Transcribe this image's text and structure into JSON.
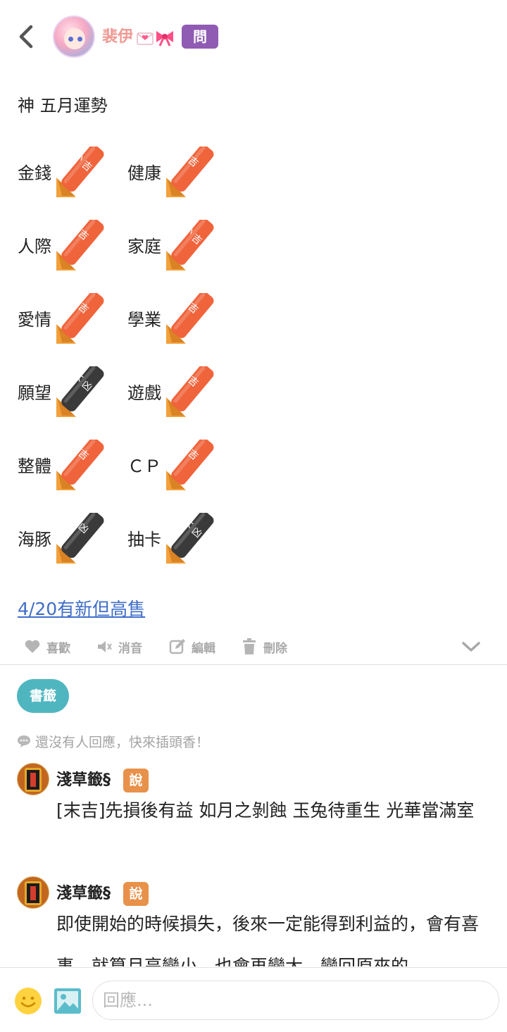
{
  "header": {
    "author_name": "裴伊",
    "ask_badge": "問"
  },
  "post": {
    "title": "神 五月運勢",
    "fortunes": [
      {
        "label": "金錢",
        "result": "小吉"
      },
      {
        "label": "健康",
        "result": "吉"
      },
      {
        "label": "人際",
        "result": "吉"
      },
      {
        "label": "家庭",
        "result": "小吉"
      },
      {
        "label": "愛情",
        "result": "吉"
      },
      {
        "label": "學業",
        "result": "吉"
      },
      {
        "label": "願望",
        "result": "大凶"
      },
      {
        "label": "遊戲",
        "result": "吉"
      },
      {
        "label": "整體",
        "result": "吉"
      },
      {
        "label": "ＣＰ",
        "result": "吉"
      },
      {
        "label": "海豚",
        "result": "凶"
      },
      {
        "label": "抽卡",
        "result": "大凶"
      }
    ],
    "link_text": "4/20有新但高售"
  },
  "actions": {
    "like": "喜歡",
    "mute": "消音",
    "edit": "編輯",
    "delete": "刪除"
  },
  "bookmark_label": "書籤",
  "no_reply_text": "還沒有人回應，快來插頭香！",
  "comments": [
    {
      "name": "淺草籤§",
      "badge": "說",
      "text": "[末吉]先損後有益 如月之剝蝕 玉兔待重生 光華當滿室"
    },
    {
      "name": "淺草籤§",
      "badge": "說",
      "text": "即使開始的時候損失，後來一定能得到利益的，會有喜事。就算月亮變小，也會再變大，變回原來的"
    }
  ],
  "reply_bar": {
    "placeholder": "回應..."
  },
  "colors": {
    "author": "#f09a94",
    "ask_badge": "#8f5bb3",
    "link": "#3f6ec8",
    "bookmark": "#4fb6c0",
    "say_badge": "#e8914a",
    "lucky_stick": "#f0643c",
    "bad_stick": "#3a3a3a"
  }
}
